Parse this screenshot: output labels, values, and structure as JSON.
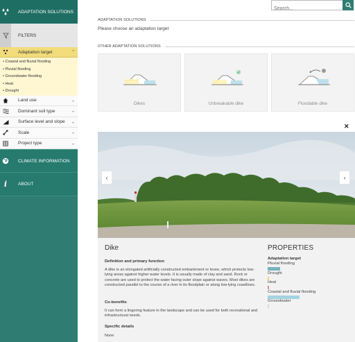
{
  "sidebar": {
    "header": {
      "label": "ADAPTATION SOLUTIONS",
      "icon": "drops-icon"
    },
    "filters": {
      "label": "FILTERS",
      "icon": "funnel-icon"
    },
    "adaptation_target": {
      "label": "Adaptation target",
      "icon": "target-icon",
      "expanded": true
    },
    "target_items": [
      "Coastal and fluvial flooding",
      "Pluvial flooding",
      "Groundwater flooding",
      "Heat",
      "Drought"
    ],
    "filter_rows": [
      {
        "label": "Land use",
        "icon": "house-icon"
      },
      {
        "label": "Dominant soil type",
        "icon": "waves-icon"
      },
      {
        "label": "Surface level and slope",
        "icon": "slope-icon"
      },
      {
        "label": "Scale",
        "icon": "arrows-icon"
      },
      {
        "label": "Project type",
        "icon": "grid-icon"
      }
    ],
    "climate": {
      "label": "CLIMATE INFORMATION",
      "icon": "globe-icon"
    },
    "about": {
      "label": "ABOUT",
      "icon": "info-icon"
    }
  },
  "search": {
    "placeholder": "Search...",
    "value": ""
  },
  "main": {
    "section1_title": "ADAPTATION SOLUTIONS",
    "prompt": "Please choose an adaptation target",
    "section2_title": "OTHER ADAPTATION SOLUTIONS",
    "cards": [
      {
        "label": "Dikes"
      },
      {
        "label": "Unbreakable dike"
      },
      {
        "label": "Floodable dike"
      }
    ]
  },
  "detail": {
    "title": "Dike",
    "definition_heading": "Definition and primary function",
    "definition_text": "A dike is an elongated artificially constructed embankment or levee, which protects low-lying areas against higher water levels. It is usually made of clay and sand. Rock or concrete are used to protect the water facing outer slope against waves. Most dikes are constructed parallel to the course of a river in its floodplain or along low-lying coastlines.",
    "cobenefits_heading": "Co-benefits",
    "cobenefits_text": "It can form a lingering feature in the landscape and can be used for both recreational and infrastructural needs.",
    "specific_heading": "Specific details",
    "specific_text": "None"
  },
  "properties": {
    "title": "PROPERTIES",
    "subtitle": "Adaptation target",
    "items": [
      {
        "label": "Pluvial flooding",
        "level": 0.4,
        "color": "#79b3bd"
      },
      {
        "label": "Drought",
        "level": 0.05,
        "color": "#f2d17a"
      },
      {
        "label": "Heat",
        "level": 0.05,
        "color": "#e6849a"
      },
      {
        "label": "Coastal and fluvial flooding",
        "level": 1.0,
        "color": "#a5d3e0"
      },
      {
        "label": "Groundwater",
        "level": 0.05,
        "color": "#d9d9d9"
      }
    ]
  },
  "colors": {
    "brand": "#2f7d72",
    "highlight": "#f2dc7a"
  }
}
